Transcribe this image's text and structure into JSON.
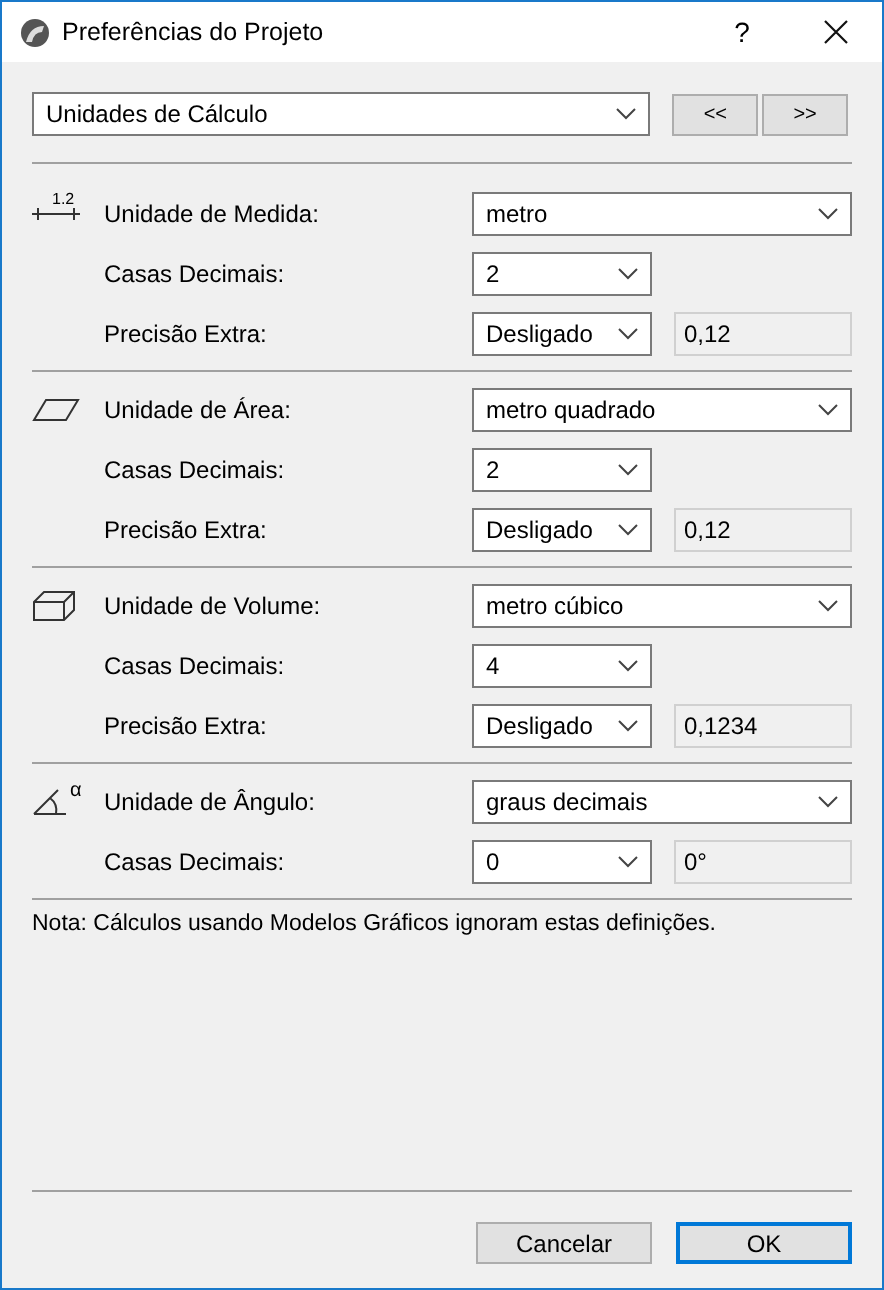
{
  "window": {
    "title": "Preferências do Projeto",
    "help": "?"
  },
  "category": {
    "value": "Unidades de Cálculo"
  },
  "nav_buttons": [
    "<<",
    ">>"
  ],
  "sections": [
    {
      "icon_text": "1.2",
      "rows": [
        {
          "kind": "wide",
          "label": "Unidade de Medida:",
          "value": "metro"
        },
        {
          "kind": "narrow",
          "label": "Casas Decimais:",
          "value": "2"
        },
        {
          "kind": "narrow",
          "label": "Precisão Extra:",
          "value": "Desligado",
          "reading": "0,12"
        }
      ]
    },
    {
      "rows": [
        {
          "kind": "wide",
          "label": "Unidade de Área:",
          "value": "metro quadrado"
        },
        {
          "kind": "narrow",
          "label": "Casas Decimais:",
          "value": "2"
        },
        {
          "kind": "narrow",
          "label": "Precisão Extra:",
          "value": "Desligado",
          "reading": "0,12"
        }
      ]
    },
    {
      "rows": [
        {
          "kind": "wide",
          "label": "Unidade de Volume:",
          "value": "metro cúbico"
        },
        {
          "kind": "narrow",
          "label": "Casas Decimais:",
          "value": "4"
        },
        {
          "kind": "narrow",
          "label": "Precisão Extra:",
          "value": "Desligado",
          "reading": "0,1234"
        }
      ]
    },
    {
      "icon_text": "α",
      "rows": [
        {
          "kind": "wide",
          "label": "Unidade de Ângulo:",
          "value": "graus decimais"
        },
        {
          "kind": "narrow",
          "label": "Casas Decimais:",
          "value": "0",
          "reading": "0°"
        }
      ]
    }
  ],
  "note": "Nota: Cálculos usando Modelos Gráficos ignoram estas definições.",
  "buttons": [
    {
      "label": "Cancelar",
      "default": false
    },
    {
      "label": "OK",
      "default": true
    }
  ]
}
